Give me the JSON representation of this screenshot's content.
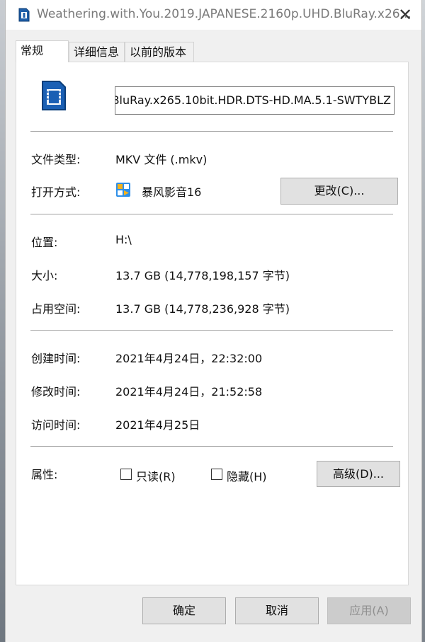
{
  "window": {
    "title": "Weathering.with.You.2019.JAPANESE.2160p.UHD.BluRay.x26...",
    "close_glyph": "✕"
  },
  "tabs": [
    {
      "label": "常规",
      "active": true
    },
    {
      "label": "详细信息",
      "active": false
    },
    {
      "label": "以前的版本",
      "active": false
    }
  ],
  "general": {
    "file_name": "BluRay.x265.10bit.HDR.DTS-HD.MA.5.1-SWTYBLZ",
    "type_label": "文件类型:",
    "type_value": "MKV 文件 (.mkv)",
    "open_with_label": "打开方式:",
    "open_with_app": "暴风影音16",
    "change_button": "更改(C)...",
    "location_label": "位置:",
    "location_value": "H:\\",
    "size_label": "大小:",
    "size_value": "13.7 GB (14,778,198,157 字节)",
    "disk_size_label": "占用空间:",
    "disk_size_value": "13.7 GB (14,778,236,928 字节)",
    "created_label": "创建时间:",
    "created_value": "2021年4月24日，22:32:00",
    "modified_label": "修改时间:",
    "modified_value": "2021年4月24日，21:52:58",
    "accessed_label": "访问时间:",
    "accessed_value": "2021年4月25日",
    "attributes_label": "属性:",
    "readonly_label": "只读(R)",
    "readonly_checked": false,
    "hidden_label": "隐藏(H)",
    "hidden_checked": false,
    "advanced_button": "高级(D)..."
  },
  "footer": {
    "ok": "确定",
    "cancel": "取消",
    "apply": "应用(A)"
  },
  "icons": {
    "file": "video-file-icon",
    "app": "baofeng-player-icon",
    "close": "close-icon"
  }
}
